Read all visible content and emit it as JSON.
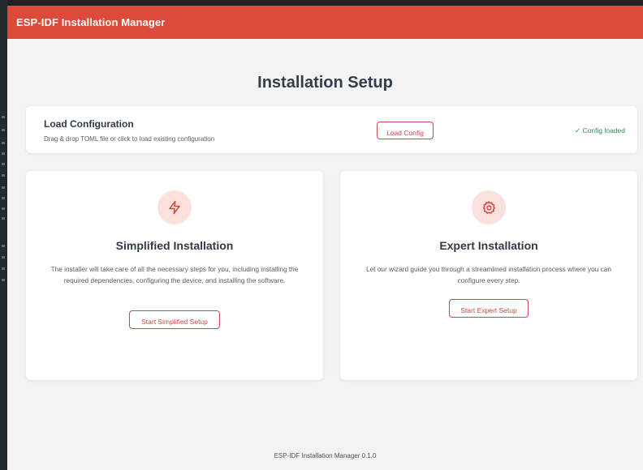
{
  "app": {
    "title": "ESP-IDF Installation Manager"
  },
  "page": {
    "title": "Installation Setup"
  },
  "load_config": {
    "title": "Load Configuration",
    "description": "Drag & drop TOML file or click to load existing configuration",
    "button_label": "Load Config",
    "status": "✓ Config loaded"
  },
  "simplified": {
    "icon": "lightning-icon",
    "title": "Simplified Installation",
    "description": "The installer will take care of all the necessary steps for you, including installing the required dependencies, configuring the device, and installing the software.",
    "button_label": "Start Simplified Setup"
  },
  "expert": {
    "icon": "gear-icon",
    "title": "Expert Installation",
    "description": "Let our wizard guide you through a streamlined installation process where you can configure every step.",
    "button_label": "Start Expert Setup"
  },
  "footer": {
    "text": "ESP-IDF Installation Manager 0.1.0"
  },
  "colors": {
    "accent": "#dc4a3a",
    "button_border": "#c9464a",
    "success": "#2e8a57",
    "icon_bg": "#fbe1de"
  }
}
